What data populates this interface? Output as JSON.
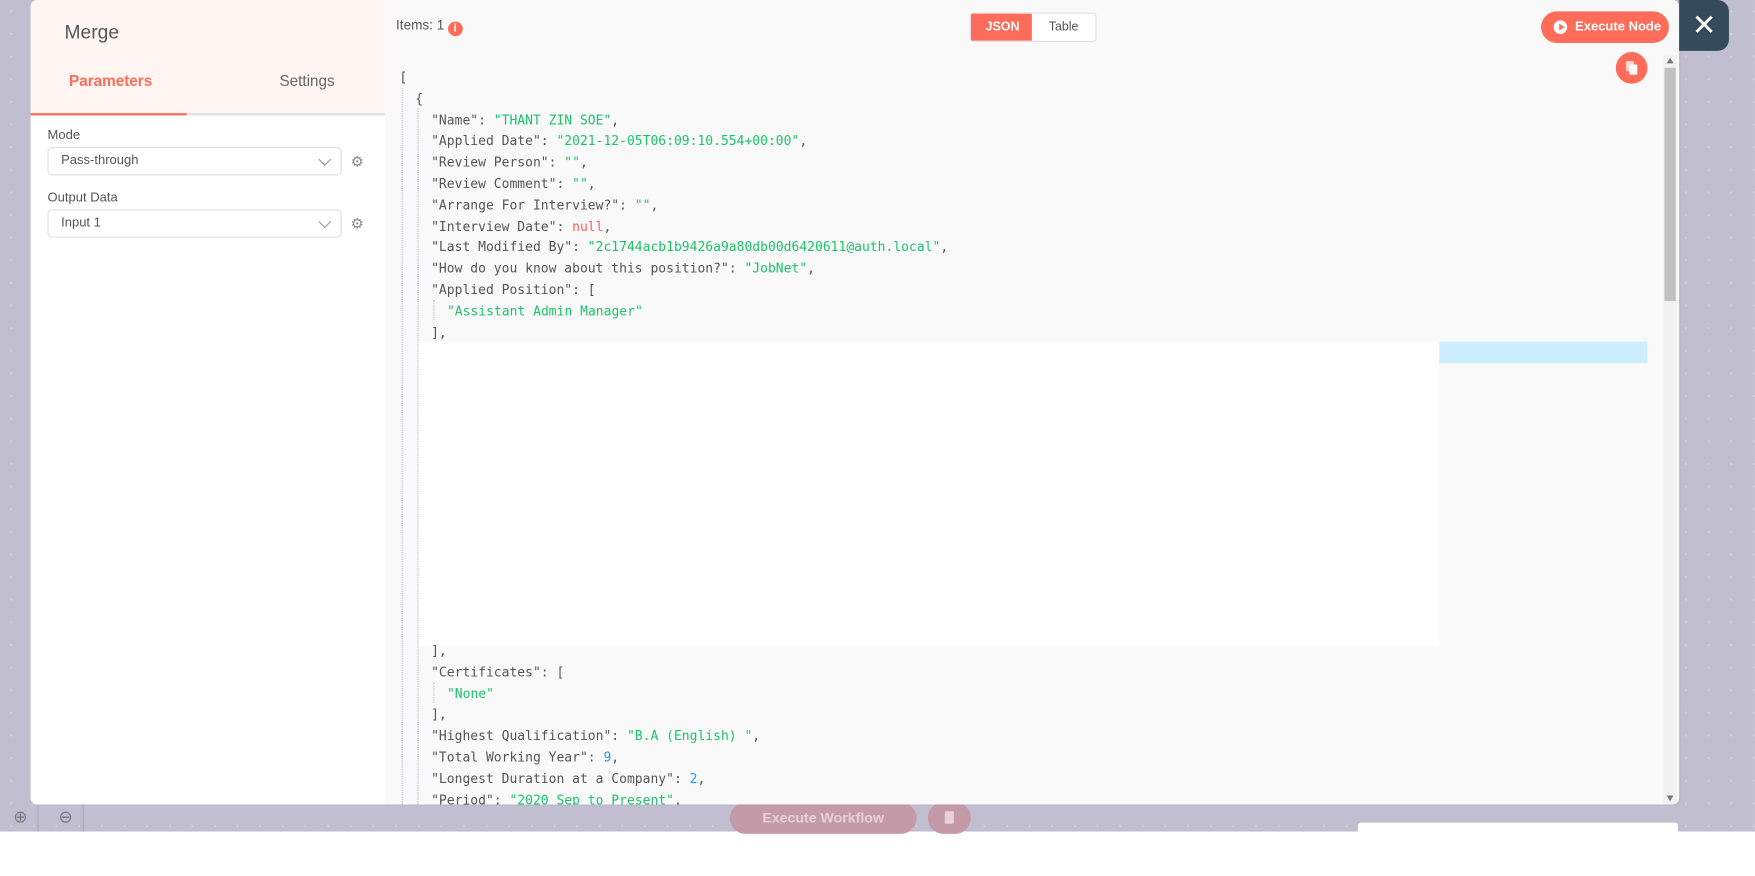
{
  "node": {
    "title": "Merge"
  },
  "tabs": [
    {
      "label": "Parameters",
      "active": true
    },
    {
      "label": "Settings",
      "active": false
    }
  ],
  "fields": [
    {
      "label": "Mode",
      "value": "Pass-through"
    },
    {
      "label": "Output Data",
      "value": "Input 1"
    }
  ],
  "output": {
    "items_label": "Items: 1",
    "info_icon": "i",
    "view_toggle": [
      {
        "label": "JSON",
        "active": true
      },
      {
        "label": "Table",
        "active": false
      }
    ],
    "execute_node_label": "Execute Node",
    "close_icon": "✕"
  },
  "json_top": [
    [
      [
        "p",
        "["
      ]
    ],
    [
      [
        "p",
        "{"
      ]
    ],
    [
      [
        "p",
        "\"Name\": "
      ],
      [
        "s",
        "\"THANT ZIN SOE\""
      ],
      [
        "p",
        ","
      ]
    ],
    [
      [
        "p",
        "\"Applied Date\": "
      ],
      [
        "s",
        "\"2021-12-05T06:09:10.554+00:00\""
      ],
      [
        "p",
        ","
      ]
    ],
    [
      [
        "p",
        "\"Review Person\": "
      ],
      [
        "s",
        "\"\""
      ],
      [
        "p",
        ","
      ]
    ],
    [
      [
        "p",
        "\"Review Comment\": "
      ],
      [
        "s",
        "\"\""
      ],
      [
        "p",
        ","
      ]
    ],
    [
      [
        "p",
        "\"Arrange For Interview?\": "
      ],
      [
        "s",
        "\"\""
      ],
      [
        "p",
        ","
      ]
    ],
    [
      [
        "p",
        "\"Interview Date\": "
      ],
      [
        "nl",
        "null"
      ],
      [
        "p",
        ","
      ]
    ],
    [
      [
        "p",
        "\"Last Modified By\": "
      ],
      [
        "s",
        "\"2c1744acb1b9426a9a80db00d6420611@auth.local\""
      ],
      [
        "p",
        ","
      ]
    ],
    [
      [
        "p",
        "\"How do you know about this position?\": "
      ],
      [
        "s",
        "\"JobNet\""
      ],
      [
        "p",
        ","
      ]
    ],
    [
      [
        "p",
        "\"Applied Position\": ["
      ]
    ],
    [
      [
        "s",
        "\"Assistant Admin Manager\""
      ]
    ],
    [
      [
        "p",
        "],"
      ]
    ]
  ],
  "json_bottom": [
    [
      [
        "p",
        "],"
      ]
    ],
    [
      [
        "p",
        "\"Certificates\": ["
      ]
    ],
    [
      [
        "s",
        "\"None\""
      ]
    ],
    [
      [
        "p",
        "],"
      ]
    ],
    [
      [
        "p",
        "\"Highest Qualification\": "
      ],
      [
        "s",
        "\"B.A (English) \""
      ],
      [
        "p",
        ","
      ]
    ],
    [
      [
        "p",
        "\"Total Working Year\": "
      ],
      [
        "n",
        "9"
      ],
      [
        "p",
        ","
      ]
    ],
    [
      [
        "p",
        "\"Longest Duration at a Company\": "
      ],
      [
        "n",
        "2"
      ],
      [
        "p",
        ","
      ]
    ],
    [
      [
        "p",
        "\"Period\": "
      ],
      [
        "s",
        "\"2020 Sep to Present\""
      ],
      [
        "p",
        ","
      ]
    ]
  ],
  "canvas": {
    "execute_workflow_label": "Execute Workflow"
  },
  "colors": {
    "accent": "#ff6d5a",
    "string": "#1dc36b",
    "number": "#2196f3",
    "null": "#ff5a5a",
    "close_bg": "#354a5a"
  }
}
